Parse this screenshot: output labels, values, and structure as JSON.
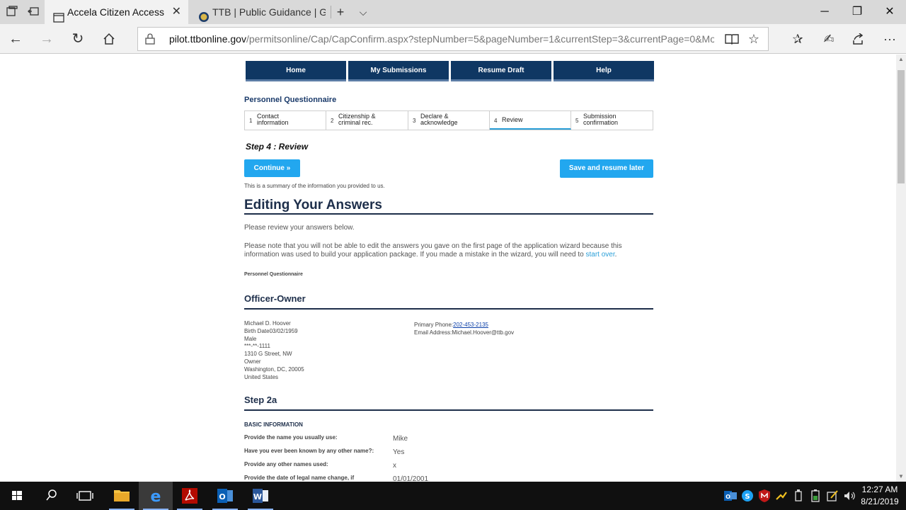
{
  "browser": {
    "tabs": [
      {
        "title": "Accela Citizen Access",
        "active": true
      },
      {
        "title": "TTB | Public Guidance | Guic",
        "active": false
      }
    ],
    "url_domain": "pilot.ttbonline.gov",
    "url_rest": "/permitsonline/Cap/CapConfirm.aspx?stepNumber=5&pageNumber=1&currentStep=3&currentPage=0&Module="
  },
  "nav": [
    {
      "label": "Home"
    },
    {
      "label": "My Submissions"
    },
    {
      "label": "Resume Draft"
    },
    {
      "label": "Help"
    }
  ],
  "wizard": {
    "title": "Personnel Questionnaire",
    "steps": [
      {
        "num": "1",
        "label": "Contact information"
      },
      {
        "num": "2",
        "label": "Citizenship & criminal rec."
      },
      {
        "num": "3",
        "label": "Declare & acknowledge"
      },
      {
        "num": "4",
        "label": "Review",
        "current": true
      },
      {
        "num": "5",
        "label": "Submission confirmation"
      }
    ]
  },
  "step_heading": "Step 4 : Review",
  "buttons": {
    "continue": "Continue »",
    "save_resume": "Save and resume later"
  },
  "summary_note": "This is a summary of the information you provided to us.",
  "editing": {
    "heading": "Editing Your Answers",
    "review_text": "Please review your answers below.",
    "note_text": "Please note that you will not be able to edit the answers you gave on the first page of the application wizard because this information was used to build your application package. If you made a mistake in the wizard, you will need to",
    "start_over": "start over",
    "note_end": ".",
    "section_label": "Personnel Questionnaire"
  },
  "officer": {
    "heading": "Officer-Owner",
    "name": "Michael D. Hoover",
    "birth_date": "Birth Date03/02/1959",
    "gender": "Male",
    "ssn": "***-**-1111",
    "street": "1310 G Street, NW",
    "role": "Owner",
    "city_state_zip": "Washington, DC, 20005",
    "country": "United States",
    "phone_label": "Primary Phone:",
    "phone": "202-453-2135",
    "email_line": "Email Address:Michael.Hoover@ttb.gov"
  },
  "step2a": {
    "heading": "Step 2a",
    "basic_info": "BASIC INFORMATION",
    "questions": [
      {
        "q": "Provide the name you usually use:",
        "a": "Mike"
      },
      {
        "q": "Have you ever been known by any other name?:",
        "a": "Yes"
      },
      {
        "q": "Provide any other names used:",
        "a": "x"
      },
      {
        "q": "Provide the date of legal name change, if",
        "a": "01/01/2001"
      }
    ]
  },
  "system": {
    "time": "12:27 AM",
    "date": "8/21/2019"
  }
}
